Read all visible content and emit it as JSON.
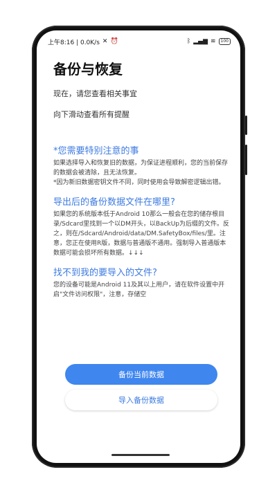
{
  "status_bar": {
    "time_info": "上午8:16 | 0.0K/s",
    "battery": "100"
  },
  "header": {
    "title": "备份与恢复",
    "subtitle1": "现在，请您查看相关事宜",
    "subtitle2": "向下滑动查看所有提醒"
  },
  "sections": [
    {
      "heading": "*您需要特别注意的事",
      "body": "如果选择导入和恢复旧的数据，为保证进程顺利，您的当前保存的数据会被清除，且无法恢复。",
      "note": "*因为新旧数据密钥文件不同，同时使用会导致解密逻辑出错。"
    },
    {
      "heading": "导出后的备份数据文件在哪里?",
      "body": "如果您的系统版本低于Android 10那么一般会在您的储存根目录/Sdcard里找到一个以DM开头，以BackUp为后缀的文件。反之，则在/Sdcard/Android/data/DM.SafetyBox/files/里。注意，您正在使用R版，数据与普通版不通用。强制导入普通版本数据可能会损坏所有数据。↓↓↓"
    },
    {
      "heading": "找不到我的要导入的文件?",
      "body": "您的设备可能是Android 11及其以上用户，请在软件设置中开启\"文件访问权限\"，注意，存储空"
    }
  ],
  "buttons": {
    "backup": "备份当前数据",
    "import": "导入备份数据"
  },
  "colors": {
    "accent": "#3f86ef",
    "heading_blue": "#3d7be0"
  }
}
